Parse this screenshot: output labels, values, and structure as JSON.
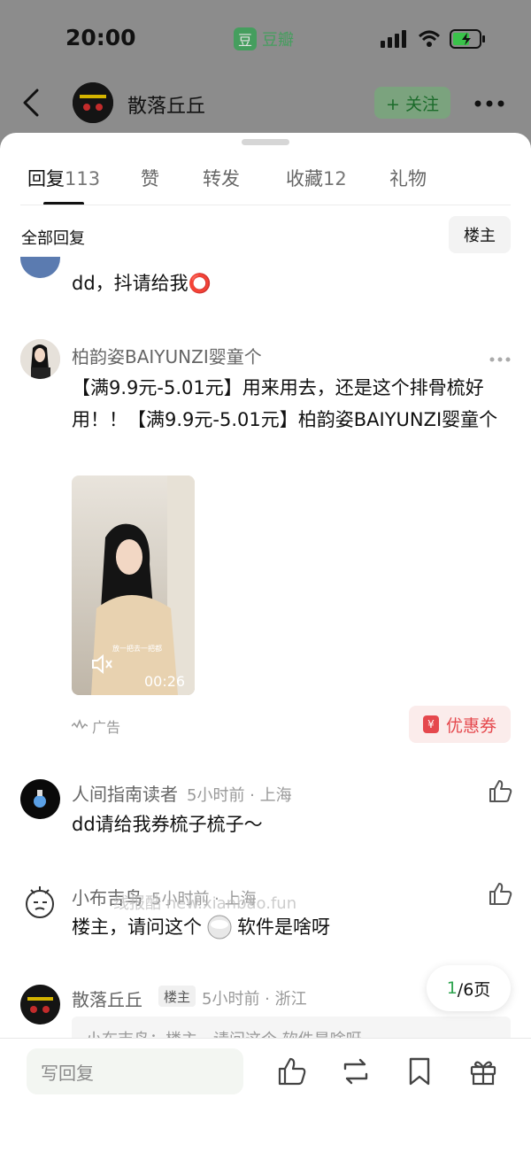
{
  "status_bar": {
    "time": "20:00",
    "app_badge": "豆瓣",
    "app_badge_icon": "豆"
  },
  "header": {
    "username": "散落丘丘",
    "follow_label": "+ 关注"
  },
  "tabs": [
    {
      "label": "回复",
      "count": "113"
    },
    {
      "label": "赞",
      "count": ""
    },
    {
      "label": "转发",
      "count": ""
    },
    {
      "label": "收藏",
      "count": "12"
    },
    {
      "label": "礼物",
      "count": ""
    }
  ],
  "filter": {
    "label": "全部回复",
    "owner_only": "楼主"
  },
  "comments": [
    {
      "text": "dd，抖请给我⭕"
    },
    {
      "name": "柏韵姿BAIYUNZI婴童个",
      "text": "【满9.9元-5.01元】用来用去，还是这个排骨梳好用！！【满9.9元-5.01元】柏韵姿BAIYUNZI婴童个",
      "video_duration": "00:26",
      "video_caption": "放一把去一把都",
      "ad_label": "广告",
      "coupon_label": "优惠券",
      "coupon_icon": "¥"
    },
    {
      "name": "人间指南读者",
      "meta": "5小时前 · 上海",
      "text": "dd请给我券梳子梳子～"
    },
    {
      "name": "小布吉鸟",
      "meta": "5小时前 · 上海",
      "text_before": "楼主，请问这个",
      "text_after": "软件是啥呀"
    },
    {
      "name": "散落丘丘",
      "badge": "楼主",
      "meta": "5小时前 · 浙江",
      "quote": "小布吉鸟：楼主，请问这个    软件是啥呀"
    }
  ],
  "watermark": "线报酷 new.xianbao.fun",
  "pagination": {
    "current": "1",
    "total": "/6页"
  },
  "bottom_bar": {
    "reply_placeholder": "写回复"
  }
}
